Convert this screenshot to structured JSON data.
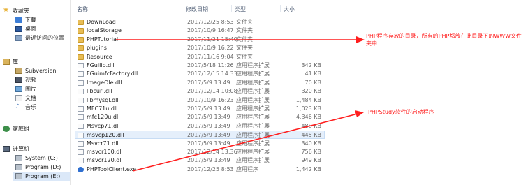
{
  "sidebar": {
    "favorites": "收藏夹",
    "favorites_items": [
      "下载",
      "桌面",
      "最近访问的位置"
    ],
    "library": "库",
    "library_items": [
      "Subversion",
      "视频",
      "图片",
      "文档",
      "音乐"
    ],
    "homegroup": "家庭组",
    "computer": "计算机",
    "drives": [
      "System (C:)",
      "Program (D:)",
      "Program (E:)"
    ]
  },
  "columns": {
    "name": "名称",
    "date": "修改日期",
    "type": "类型",
    "size": "大小"
  },
  "files": [
    {
      "name": "DownLoad",
      "date": "2017/12/25 8:53",
      "type": "文件夹",
      "size": "",
      "kind": "folder"
    },
    {
      "name": "localStorage",
      "date": "2017/10/9 16:47",
      "type": "文件夹",
      "size": "",
      "kind": "folder"
    },
    {
      "name": "PHPTutorial",
      "date": "2017/11/21 15:40",
      "type": "文件夹",
      "size": "",
      "kind": "folder"
    },
    {
      "name": "plugins",
      "date": "2017/10/9 16:22",
      "type": "文件夹",
      "size": "",
      "kind": "folder"
    },
    {
      "name": "Resource",
      "date": "2017/11/16 9:04",
      "type": "文件夹",
      "size": "",
      "kind": "folder"
    },
    {
      "name": "FGuilib.dll",
      "date": "2017/5/18 11:26",
      "type": "应用程序扩展",
      "size": "342 KB",
      "kind": "dll"
    },
    {
      "name": "FGuimfcFactory.dll",
      "date": "2017/12/15 14:33",
      "type": "应用程序扩展",
      "size": "41 KB",
      "kind": "dll"
    },
    {
      "name": "ImageOle.dll",
      "date": "2017/5/9 13:49",
      "type": "应用程序扩展",
      "size": "70 KB",
      "kind": "dll"
    },
    {
      "name": "libcurl.dll",
      "date": "2017/12/14 10:08",
      "type": "应用程序扩展",
      "size": "320 KB",
      "kind": "dll"
    },
    {
      "name": "libmysql.dll",
      "date": "2017/10/9 16:23",
      "type": "应用程序扩展",
      "size": "1,484 KB",
      "kind": "dll"
    },
    {
      "name": "MFC71u.dll",
      "date": "2017/5/9 13:49",
      "type": "应用程序扩展",
      "size": "1,023 KB",
      "kind": "dll"
    },
    {
      "name": "mfc120u.dll",
      "date": "2017/5/9 13:49",
      "type": "应用程序扩展",
      "size": "4,346 KB",
      "kind": "dll"
    },
    {
      "name": "Msvcp71.dll",
      "date": "2017/5/9 13:49",
      "type": "应用程序扩展",
      "size": "488 KB",
      "kind": "dll"
    },
    {
      "name": "msvcp120.dll",
      "date": "2017/5/9 13:49",
      "type": "应用程序扩展",
      "size": "445 KB",
      "kind": "dll",
      "selected": true
    },
    {
      "name": "Msvcr71.dll",
      "date": "2017/5/9 13:49",
      "type": "应用程序扩展",
      "size": "340 KB",
      "kind": "dll"
    },
    {
      "name": "msvcr100.dll",
      "date": "2017/12/14 13:36",
      "type": "应用程序扩展",
      "size": "756 KB",
      "kind": "dll"
    },
    {
      "name": "msvcr120.dll",
      "date": "2017/5/9 13:49",
      "type": "应用程序扩展",
      "size": "949 KB",
      "kind": "dll"
    },
    {
      "name": "PHPToolClient.exe",
      "date": "2017/12/25 8:53",
      "type": "应用程序",
      "size": "1,442 KB",
      "kind": "exe"
    }
  ],
  "annotations": {
    "phptutorial_note": "PHP程序存放的目录，所有的PHP都放在此目录下的WWW文件夹中",
    "phptoolclient_note": "PHPStudy软件的启动程序",
    "color": "#ff1e1e"
  }
}
